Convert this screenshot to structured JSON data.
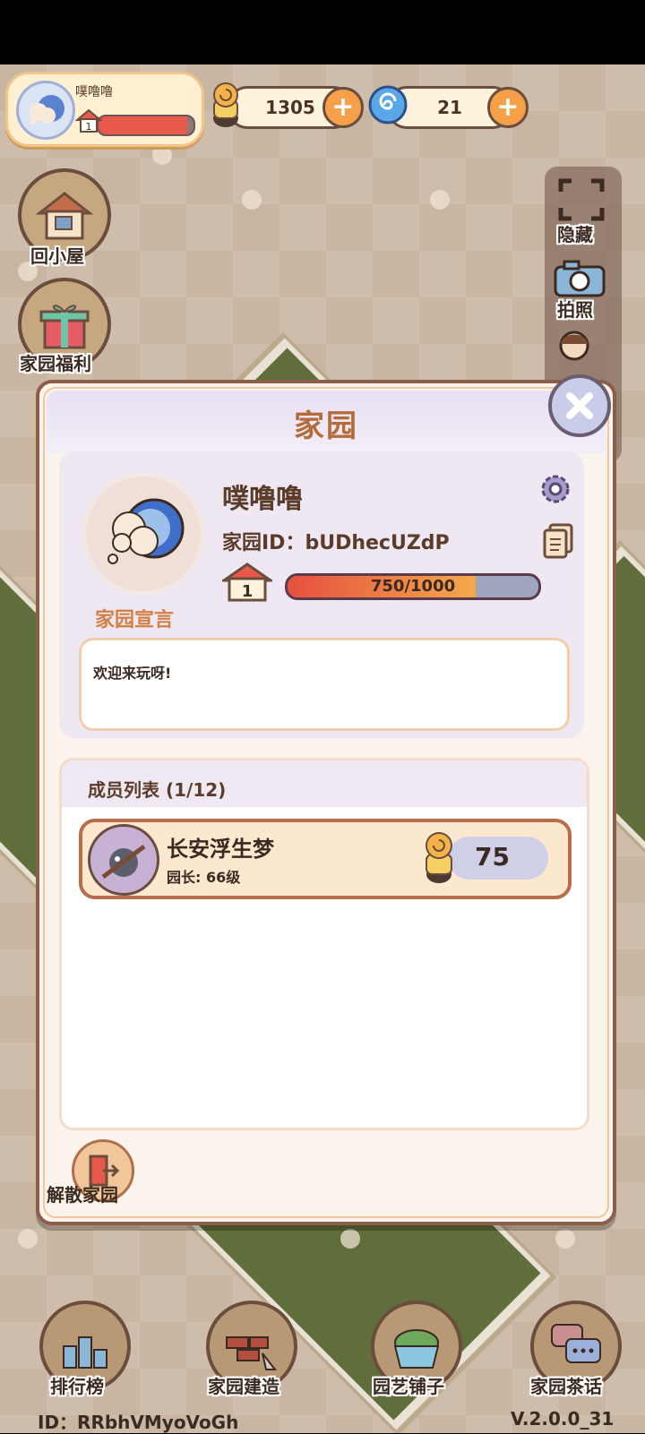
{
  "profile": {
    "name": "噗噜噜",
    "level": "1",
    "exp_fraction": 0.93
  },
  "resources": {
    "snail_coins": "1305",
    "spiral_gems": "21"
  },
  "left_buttons": {
    "home": "回小屋",
    "welfare": "家园福利"
  },
  "right_buttons": {
    "hide": "隐藏",
    "photo": "拍照"
  },
  "dialog": {
    "title": "家园",
    "home_name": "噗噜噜",
    "home_id_label": "家园ID：",
    "home_id": "bUDhecUZdP",
    "level": "1",
    "progress_text": "750/1000",
    "progress_value": 750,
    "progress_max": 1000,
    "declaration_label": "家园宣言",
    "declaration_text": "欢迎来玩呀!",
    "members_title": "成员列表 (1/12)",
    "members": [
      {
        "name": "长安浮生梦",
        "role": "园长: 66级",
        "score": "75"
      }
    ],
    "disband_label": "解散家园"
  },
  "bottom_nav": {
    "rank": "排行榜",
    "build": "家园建造",
    "shop": "园艺铺子",
    "chat": "家园茶话"
  },
  "footer": {
    "player_id": "ID：RRbhVMyoVoGh",
    "version": "V.2.0.0_31"
  },
  "colors": {
    "accent": "#f6a04a",
    "progress": "#e5503f",
    "title": "#b46b3a",
    "frame": "#8b5e49"
  }
}
